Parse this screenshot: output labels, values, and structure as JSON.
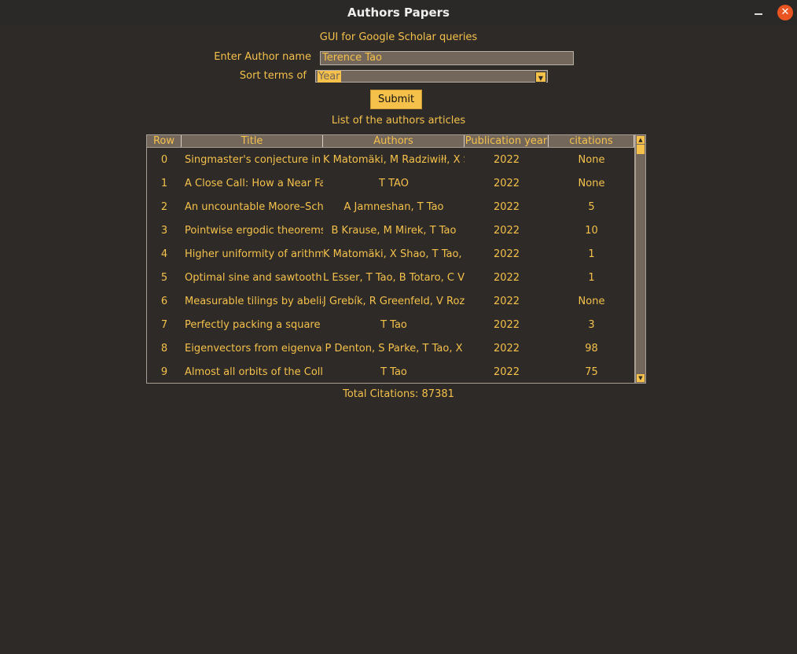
{
  "window": {
    "title": "Authors Papers"
  },
  "form": {
    "heading": "GUI for Google Scholar queries",
    "author_label": "Enter Author name",
    "author_value": "Terence Tao",
    "sort_label": "Sort terms of",
    "sort_value": "Year",
    "submit_label": "Submit",
    "list_caption": "List of the authors articles"
  },
  "table": {
    "columns": [
      "Row",
      "Title",
      "Authors",
      "Publication year",
      "citations"
    ],
    "rows": [
      [
        "0",
        "Singmaster's conjecture in the",
        "K Matomäki, M Radziwiłł, X S",
        "2022",
        "None"
      ],
      [
        "1",
        "A Close Call: How a Near Fa",
        "T TAO",
        "2022",
        "None"
      ],
      [
        "2",
        "An uncountable Moore–Schm",
        "A Jamneshan, T Tao",
        "2022",
        "5"
      ],
      [
        "3",
        "Pointwise ergodic theorems fo",
        "B Krause, M Mirek, T Tao",
        "2022",
        "10"
      ],
      [
        "4",
        "Higher uniformity of arithmetic",
        "K Matomäki, X Shao, T Tao, .",
        "2022",
        "1"
      ],
      [
        "5",
        "Optimal sine and sawtooth ine",
        "L Esser, T Tao, B Totaro, C V",
        "2022",
        "1"
      ],
      [
        "6",
        "Measurable tilings by abelian",
        "J Grebík, R Greenfeld, V Roz",
        "2022",
        "None"
      ],
      [
        "7",
        "Perfectly packing a square by",
        "T Tao",
        "2022",
        "3"
      ],
      [
        "8",
        "Eigenvectors from eigenvalue",
        "P Denton, S Parke, T Tao, X",
        "2022",
        "98"
      ],
      [
        "9",
        "Almost all orbits of the Collatz",
        "T Tao",
        "2022",
        "75"
      ]
    ]
  },
  "total_citations": "Total Citations: 87381",
  "colors": {
    "accent": "#f5c14b",
    "background": "#2d2a27",
    "field": "#73665b",
    "close": "#e95420"
  }
}
